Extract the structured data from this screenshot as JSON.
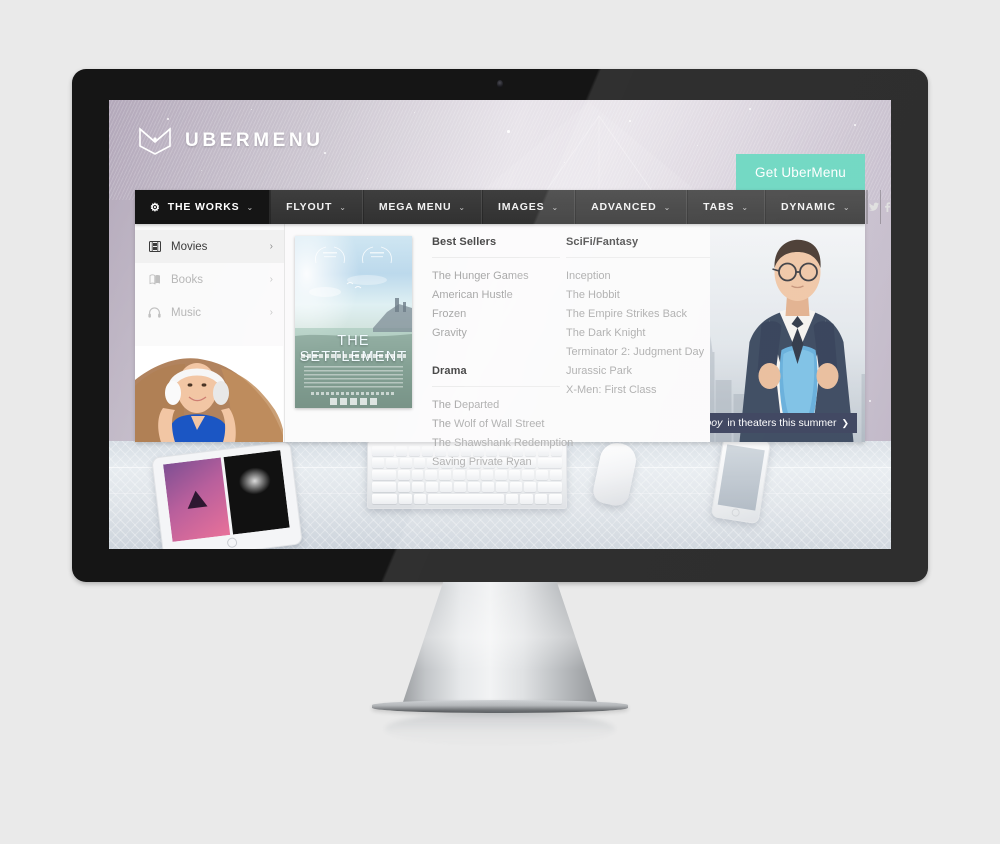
{
  "site": {
    "brand_name": "UBERMENU",
    "logo_icon": "ubermenu-logo-icon",
    "cta_label": "Get UberMenu"
  },
  "menubar": {
    "items": [
      {
        "label": "THE WORKS",
        "icon": "gear-icon",
        "caret": "⌄",
        "active": true
      },
      {
        "label": "FLYOUT",
        "caret": "⌄",
        "active": false
      },
      {
        "label": "MEGA MENU",
        "caret": "⌄",
        "active": false
      },
      {
        "label": "IMAGES",
        "caret": "⌄",
        "active": false
      },
      {
        "label": "ADVANCED",
        "caret": "⌄",
        "active": false
      },
      {
        "label": "TABS",
        "caret": "⌄",
        "active": false
      },
      {
        "label": "DYNAMIC",
        "caret": "⌄",
        "active": false
      }
    ],
    "icons": [
      {
        "name": "twitter-icon"
      },
      {
        "name": "facebook-icon"
      },
      {
        "name": "search-icon"
      }
    ]
  },
  "mega_menu": {
    "rail": [
      {
        "label": "Movies",
        "icon": "film-icon",
        "arrow": "›",
        "active": true
      },
      {
        "label": "Books",
        "icon": "book-icon",
        "arrow": "›",
        "active": false
      },
      {
        "label": "Music",
        "icon": "headphones-icon",
        "arrow": "›",
        "active": false
      }
    ],
    "rail_photo_alt": "woman-with-headphones-photo",
    "poster": {
      "title": "THE SETTLEMENT",
      "alt": "the-settlement-movie-poster"
    },
    "columns": [
      {
        "groups": [
          {
            "heading": "Best Sellers",
            "items": [
              "The Hunger Games",
              "American Hustle",
              "Frozen",
              "Gravity"
            ]
          },
          {
            "heading": "Drama",
            "items": [
              "The Departed",
              "The Wolf of Wall Street",
              "The Shawshank Redemption",
              "Saving Private Ryan"
            ]
          }
        ]
      },
      {
        "groups": [
          {
            "heading": "SciFi/Fantasy",
            "items": [
              "Inception",
              "The Hobbit",
              "The Empire Strikes Back",
              "The Dark Knight",
              "Terminator 2: Judgment Day",
              "Jurassic Park",
              "X-Men: First Class"
            ]
          }
        ]
      }
    ],
    "promo": {
      "alt": "superhero-businessman-photo",
      "caption_title": "Wonderboy",
      "caption_rest": "in theaters this summer",
      "caption_arrow": "❯"
    }
  },
  "desk": {
    "tablet_alt": "tablet-with-album-art",
    "keyboard_alt": "wireless-keyboard",
    "mouse_alt": "wireless-mouse",
    "phone_alt": "smartphone"
  },
  "device": {
    "alt": "desktop-monitor-mockup",
    "webcam": "webcam-icon"
  },
  "colors": {
    "accent": "#63d4bd",
    "menubar": "#313131",
    "menubar_active": "#151515",
    "caption_bg": "#2b3350",
    "page_bg": "#eaeaea"
  }
}
